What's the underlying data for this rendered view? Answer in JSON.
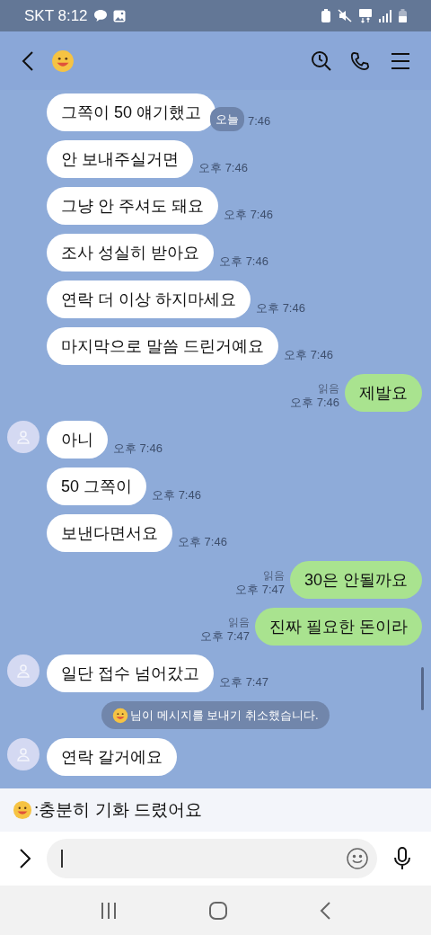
{
  "status_bar": {
    "carrier_time": "SKT 8:12"
  },
  "messages": [
    {
      "kind": "received",
      "text": "그쪽이 50 얘기했고",
      "time": "7:46",
      "date_chip": "오늘",
      "avatar": false
    },
    {
      "kind": "received",
      "text": "안 보내주실거면",
      "time": "오후 7:46",
      "avatar": false
    },
    {
      "kind": "received",
      "text": "그냥 안 주셔도 돼요",
      "time": "오후 7:46",
      "avatar": false
    },
    {
      "kind": "received",
      "text": "조사 성실히 받아요",
      "time": "오후 7:46",
      "avatar": false
    },
    {
      "kind": "received",
      "text": "연락 더 이상 하지마세요",
      "time": "오후 7:46",
      "avatar": false
    },
    {
      "kind": "received",
      "text": "마지막으로 말씀 드린거예요",
      "time": "오후 7:46",
      "avatar": false
    },
    {
      "kind": "sent",
      "text": "제발요",
      "time": "오후 7:46",
      "read": "읽음"
    },
    {
      "kind": "received",
      "text": "아니",
      "time": "오후 7:46",
      "avatar": true
    },
    {
      "kind": "received",
      "text": "50 그쪽이",
      "time": "오후 7:46",
      "avatar": false
    },
    {
      "kind": "received",
      "text": "보낸다면서요",
      "time": "오후 7:46",
      "avatar": false
    },
    {
      "kind": "sent",
      "text": "30은 안될까요",
      "time": "오후 7:47",
      "read": "읽음"
    },
    {
      "kind": "sent",
      "text": "진짜 필요한 돈이라",
      "time": "오후 7:47",
      "read": "읽음"
    },
    {
      "kind": "received",
      "text": "일단 접수 넘어갔고",
      "time": "오후 7:47",
      "avatar": true
    },
    {
      "kind": "system",
      "text": "님이 메시지를 보내기 취소했습니다."
    },
    {
      "kind": "received",
      "text": "연락 갈거에요",
      "avatar": true
    }
  ],
  "preview": {
    "text": ":충분히 기화 드렸어요"
  }
}
